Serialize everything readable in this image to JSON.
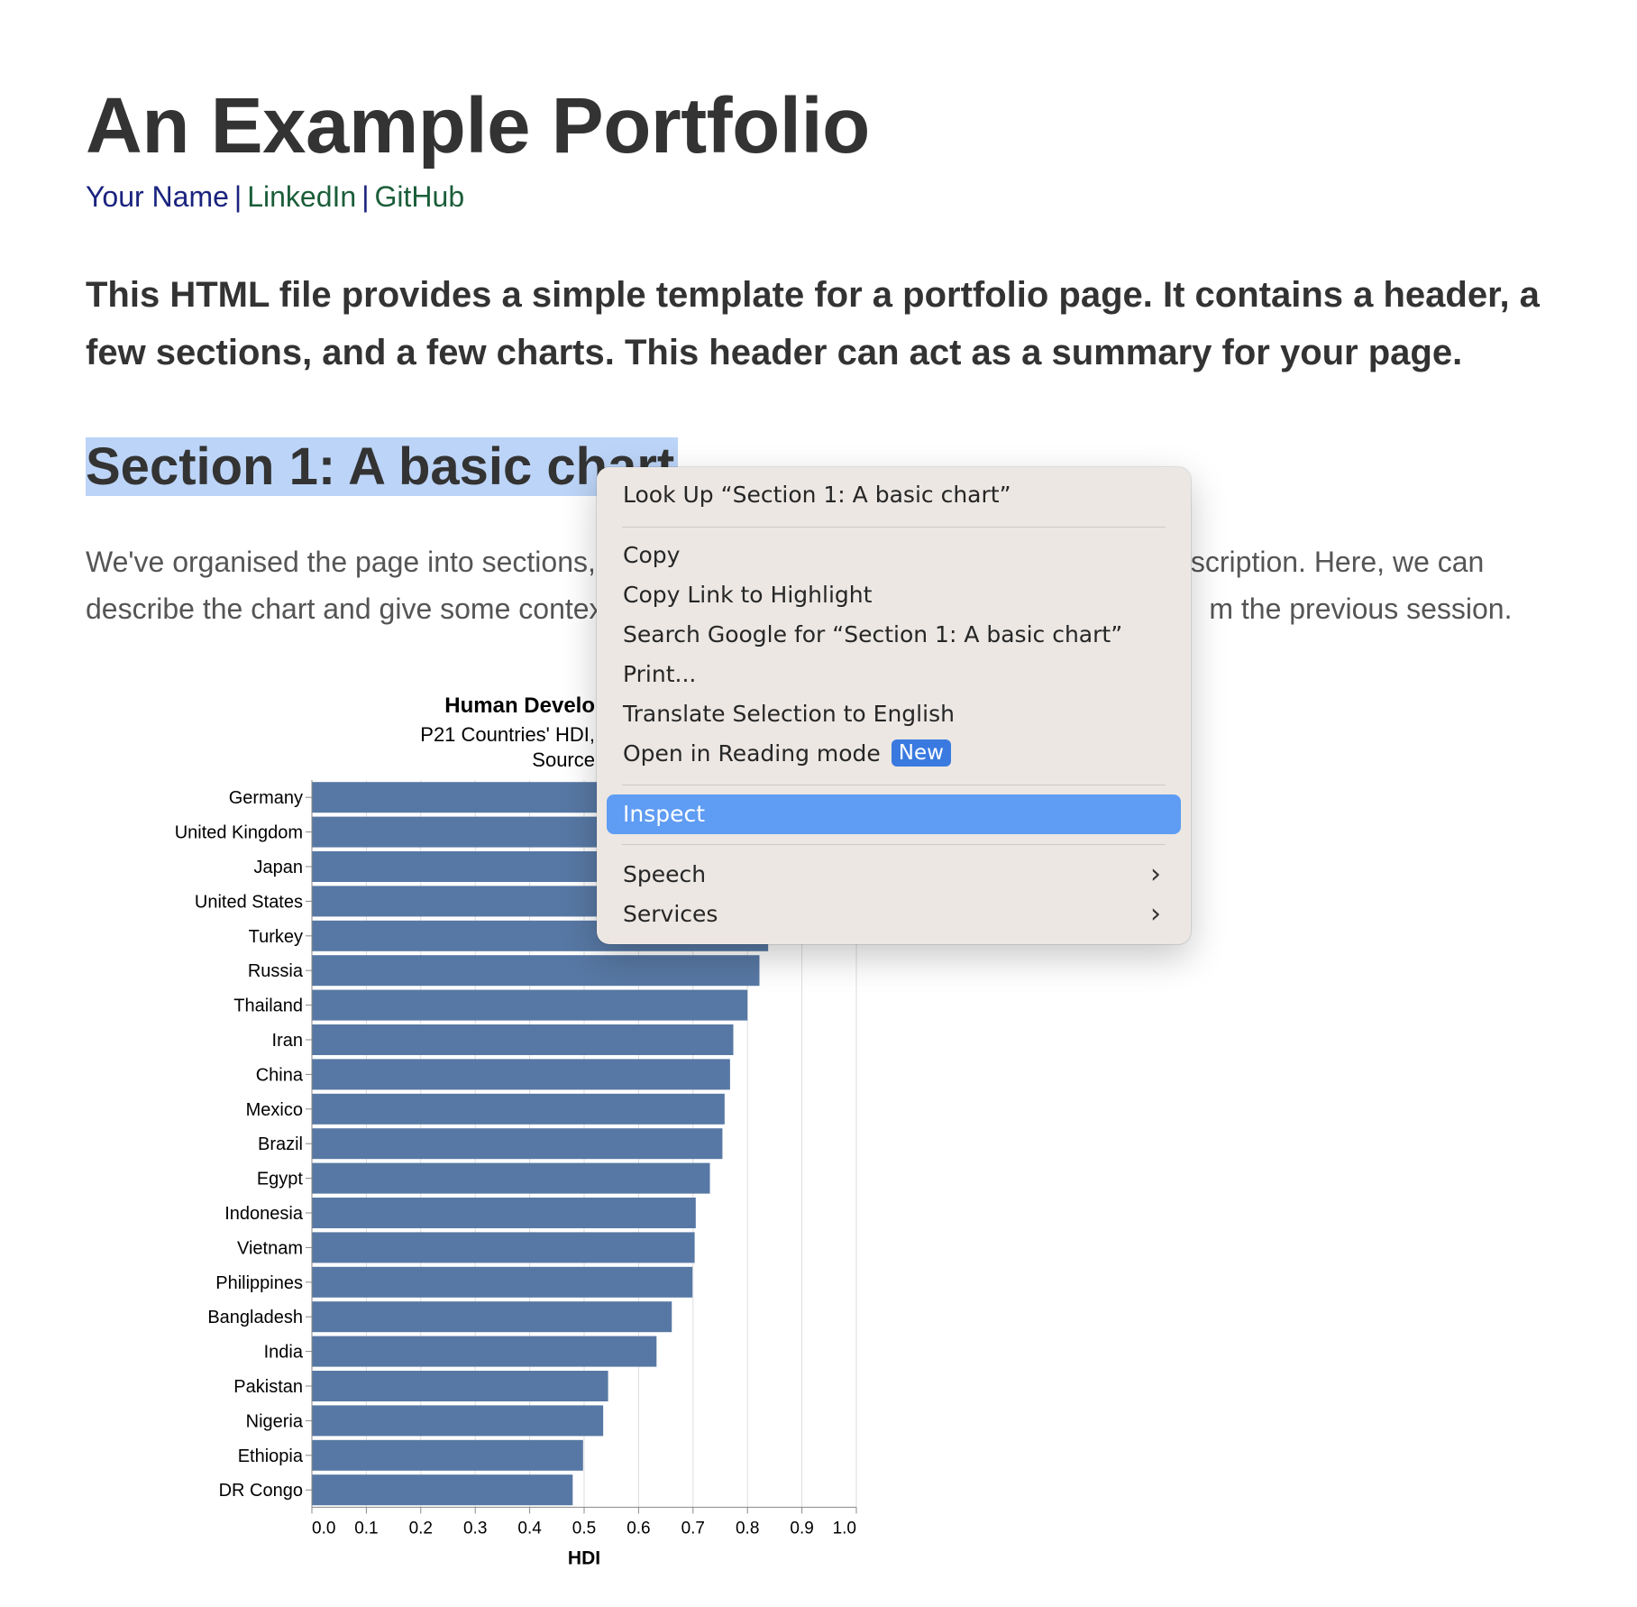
{
  "page": {
    "title": "An Example Portfolio",
    "links": {
      "name": "Your Name",
      "sep": "|",
      "linkedin": "LinkedIn",
      "github": "GitHub"
    },
    "intro": "This HTML file provides a simple template for a portfolio page. It contains a header, a few sections, and a few charts. This header can act as a summary for your page.",
    "section1": {
      "title": "Section 1: A basic chart",
      "desc_line1_left": "We've organised the page into sections, w",
      "desc_line1_right": "scription. Here, we can",
      "desc_line2_left": "describe the chart and give some context.",
      "desc_line2_right": "m the previous session."
    }
  },
  "context_menu": {
    "items": [
      {
        "label": "Look Up “Section 1: A basic chart”"
      },
      {
        "label": "Copy"
      },
      {
        "label": "Copy Link to Highlight"
      },
      {
        "label": "Search Google for “Section 1: A basic chart”"
      },
      {
        "label": "Print..."
      },
      {
        "label": "Translate Selection to English"
      },
      {
        "label": "Open in Reading mode",
        "badge": "New"
      },
      {
        "label": "Inspect"
      },
      {
        "label": "Speech"
      },
      {
        "label": "Services"
      }
    ],
    "active_item": "Inspect",
    "active_color": "#5f9cf3"
  },
  "chart_data": {
    "type": "bar",
    "orientation": "horizontal",
    "title_visible": "Human Develo",
    "subtitle_visible": "P21 Countries' HDI,",
    "source_visible": "Source",
    "xlabel": "HDI",
    "xlim": [
      0,
      1.0
    ],
    "xticks": [
      "0.0",
      "0.1",
      "0.2",
      "0.3",
      "0.4",
      "0.5",
      "0.6",
      "0.7",
      "0.8",
      "0.9",
      "1.0"
    ],
    "grid": true,
    "bar_color": "#5778a4",
    "categories": [
      "Germany",
      "United Kingdom",
      "Japan",
      "United States",
      "Turkey",
      "Russia",
      "Thailand",
      "Iran",
      "China",
      "Mexico",
      "Brazil",
      "Egypt",
      "Indonesia",
      "Vietnam",
      "Philippines",
      "Bangladesh",
      "India",
      "Pakistan",
      "Nigeria",
      "Ethiopia",
      "DR Congo"
    ],
    "values": [
      0.942,
      0.929,
      0.925,
      0.921,
      0.838,
      0.822,
      0.8,
      0.774,
      0.768,
      0.758,
      0.754,
      0.731,
      0.705,
      0.703,
      0.699,
      0.661,
      0.633,
      0.544,
      0.535,
      0.498,
      0.479
    ]
  }
}
